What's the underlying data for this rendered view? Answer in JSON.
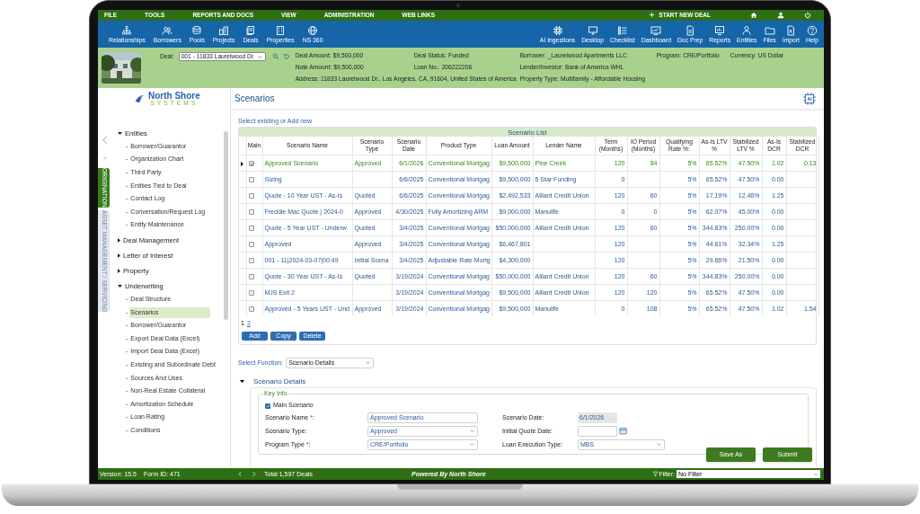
{
  "menu": {
    "items": [
      "FILE",
      "TOOLS",
      "REPORTS AND DOCS",
      "VIEW",
      "ADMINISTRATION",
      "WEB LINKS"
    ],
    "start_new_deal": "START NEW DEAL"
  },
  "toolbar": {
    "left": [
      "Relationships",
      "Borrowers",
      "Pools",
      "Projects",
      "Deals",
      "Properties",
      "NS 360"
    ],
    "right": [
      "AI Ingestions",
      "Desktop",
      "Checklist",
      "Dashboard",
      "Doc Prep",
      "Reports",
      "Entities",
      "Files",
      "Import",
      "Help"
    ]
  },
  "deal_header": {
    "deal_label": "Deal:",
    "deal_value": "001 - 11833 Laurelwood Dr.",
    "columns": [
      [
        {
          "label": "Deal Amount:",
          "value": "$9,500,000"
        },
        {
          "label": "Note Amount:",
          "value": "$9,500,000"
        },
        {
          "label": "Address:",
          "value": "11833 Laurelwood Dr., Los Angeles, CA, 91604, United States of America"
        }
      ],
      [
        {
          "label": "Deal Status:",
          "value": "Funded"
        },
        {
          "label": "Loan No.:",
          "value": "206222206"
        }
      ],
      [
        {
          "label": "Borrower:",
          "value": "_Laurelwood Apartments LLC"
        },
        {
          "label": "Lender/Investor:",
          "value": "Bank of America WHL"
        },
        {
          "label": "Property Type:",
          "value": "Multifamily - Affordable Housing"
        }
      ],
      [
        {
          "label": "Program:",
          "value": "CRE/Portfolio"
        }
      ],
      [
        {
          "label": "Currency:",
          "value": "US Dollar"
        }
      ]
    ]
  },
  "sidebar": {
    "logo": {
      "name": "North Shore",
      "tagline": "SYSTEMS"
    },
    "tabs": [
      {
        "label": "ORIGINATION",
        "selected": true
      },
      {
        "label": "ASSET MANAGEMENT / SERVICING",
        "selected": false
      }
    ],
    "sections": [
      {
        "label": "Entities",
        "expanded": true,
        "children": [
          {
            "dash": "-",
            "label": "Borrower/Guarantor",
            "selected": false
          },
          {
            "dash": "-",
            "label": "Organization Chart",
            "selected": false
          },
          {
            "dash": "-",
            "label": "Third Party",
            "selected": false
          },
          {
            "dash": "-",
            "label": "Entities Tied to Deal",
            "selected": false
          },
          {
            "dash": "-",
            "label": "Contact Log",
            "selected": false
          },
          {
            "dash": "-",
            "label": "Conversation/Request Log",
            "selected": false
          },
          {
            "dash": "-",
            "label": "Entity Maintenance",
            "selected": false
          }
        ]
      },
      {
        "label": "Deal Management",
        "expanded": false
      },
      {
        "label": "Letter of Interest",
        "expanded": false
      },
      {
        "label": "Property",
        "expanded": false
      },
      {
        "label": "Underwriting",
        "expanded": true,
        "children": [
          {
            "dash": "-",
            "label": "Deal Structure",
            "selected": false
          },
          {
            "dash": "-",
            "label": "Scenarios",
            "selected": true
          },
          {
            "dash": "-",
            "label": "Borrower/Guarantor",
            "selected": false
          },
          {
            "dash": "-",
            "label": "Export Deal Data (Excel)",
            "selected": false
          },
          {
            "dash": "-",
            "label": "Import Deal Data (Excel)",
            "selected": false
          },
          {
            "dash": "-",
            "label": "Existing and Subordinate Debt",
            "selected": false
          },
          {
            "dash": "-",
            "label": "Sources And Uses",
            "selected": false
          },
          {
            "dash": "-",
            "label": "Non-Real Estate Collateral",
            "selected": false
          },
          {
            "dash": "-",
            "label": "Amortization Schedule",
            "selected": false
          },
          {
            "dash": "-",
            "label": "Loan Rating",
            "selected": false
          },
          {
            "dash": "-",
            "label": "Conditions",
            "selected": false
          }
        ]
      }
    ]
  },
  "page_title": "Scenarios",
  "select_link": "Select existing or Add new",
  "scenario_list": {
    "title": "Scenario List",
    "columns": [
      "Main",
      "Scenario Name",
      "Scenario Type",
      "Scenario Date",
      "Product Type",
      "Loan Amount",
      "Lender Name",
      "Term (Months)",
      "IO Period (Months)",
      "Qualifying Rate %:",
      "As-Is LTV %",
      "Stabilized LTV %",
      "As-Is DCR",
      "Stabilized DCR"
    ],
    "rows": [
      {
        "selected": true,
        "main": true,
        "name": "Approved Scenario",
        "type": "Approved",
        "date": "6/1/2026",
        "product": "Conventional Mortgag",
        "amount": "$9,500,000",
        "lender": "Pine Creek",
        "term": "120",
        "io": "84",
        "rate": "5%",
        "asis_ltv": "65.52%",
        "stab_ltv": "47.50%",
        "asis_dcr": "1.02",
        "stab_dcr": "0.13"
      },
      {
        "selected": false,
        "main": false,
        "name": "Sizing",
        "date": "6/6/2025",
        "product": "Conventional Mortgag",
        "amount": "$9,500,000",
        "lender": "5 Star Funding",
        "term": "0",
        "rate": "5%",
        "asis_ltv": "65.52%",
        "stab_ltv": "47.50%",
        "asis_dcr": "0.00"
      },
      {
        "selected": false,
        "main": false,
        "name": "Quote - 10 Year UST - As-Is",
        "type": "Quoted",
        "date": "6/6/2025",
        "product": "Conventional Mortgag",
        "amount": "$2,492,533",
        "lender": "Alliant Credit Union",
        "term": "120",
        "io": "60",
        "rate": "5%",
        "asis_ltv": "17.19%",
        "stab_ltv": "12.46%",
        "asis_dcr": "1.25"
      },
      {
        "selected": false,
        "main": false,
        "name": "Freddie Mac Quote | 2024-0",
        "type": "Approved",
        "date": "4/30/2025",
        "product": "Fully Amortizing ARM",
        "amount": "$9,000,000",
        "lender": "Manulife",
        "term": "0",
        "io": "0",
        "rate": "5%",
        "asis_ltv": "62.07%",
        "stab_ltv": "45.00%",
        "asis_dcr": "0.00"
      },
      {
        "selected": false,
        "main": false,
        "name": "Quote - 5 Year UST - Underw",
        "type": "Quoted",
        "date": "3/4/2025",
        "product": "Conventional Mortgag",
        "amount": "$50,000,000",
        "lender": "Alliant Credit Union",
        "term": "120",
        "io": "60",
        "rate": "5%",
        "asis_ltv": "344.83%",
        "stab_ltv": "250.00%",
        "asis_dcr": "0.00"
      },
      {
        "selected": false,
        "main": false,
        "name": "Approved",
        "type": "Approved",
        "date": "3/4/2025",
        "product": "Conventional Mortgag",
        "amount": "$6,467,801",
        "term": "120",
        "rate": "5%",
        "asis_ltv": "44.61%",
        "stab_ltv": "32.34%",
        "asis_dcr": "1.25"
      },
      {
        "selected": false,
        "main": false,
        "name": "001 - 11|2024-03-07|00:49",
        "type": "Initial Scena",
        "date": "3/4/2025",
        "product": "Adjustable Rate Mortg",
        "amount": "$4,300,000",
        "term": "120",
        "rate": "5%",
        "asis_ltv": "29.66%",
        "stab_ltv": "21.50%",
        "asis_dcr": "0.00"
      },
      {
        "selected": false,
        "main": false,
        "name": "Quote - 30 Year UST - As-Is",
        "type": "Quoted",
        "date": "3/19/2024",
        "product": "Conventional Mortgag",
        "amount": "$50,000,000",
        "lender": "Alliant Credit Union",
        "term": "120",
        "io": "60",
        "rate": "5%",
        "asis_ltv": "344.83%",
        "stab_ltv": "250.00%",
        "asis_dcr": "0.00"
      },
      {
        "selected": false,
        "main": false,
        "name": "MJS Exit 2",
        "date": "3/19/2024",
        "product": "Conventional Mortgag",
        "amount": "$9,500,000",
        "lender": "Alliant Credit Union",
        "term": "120",
        "io": "120",
        "rate": "5%",
        "asis_ltv": "65.52%",
        "stab_ltv": "47.50%",
        "asis_dcr": "0.00"
      },
      {
        "selected": false,
        "main": false,
        "name": "Approved - 5 Years UST - Und",
        "type": "Approved",
        "date": "3/19/2024",
        "product": "Conventional Mortgag",
        "amount": "$9,500,000",
        "lender": "Manulife",
        "term": "0",
        "io": "108",
        "rate": "5%",
        "asis_ltv": "65.52%",
        "stab_ltv": "47.50%",
        "asis_dcr": "1.02",
        "stab_dcr": "1.54"
      }
    ],
    "pages": [
      {
        "label": "1",
        "selected": true
      },
      {
        "label": "2",
        "selected": false
      }
    ],
    "buttons": [
      "Add",
      "Copy",
      "Delete"
    ]
  },
  "select_function": {
    "label": "Select Function:",
    "value": "Scenario Details"
  },
  "details": {
    "title": "Scenario Details",
    "expanded": true,
    "group": "Key Info",
    "main_scenario": {
      "label": "Main Scenario",
      "checked": true
    },
    "left_fields": [
      {
        "label": "Scenario Name ",
        "required_mark": "*",
        "label_end": ":",
        "kind": "text",
        "value": "Approved Scenario"
      },
      {
        "label": "Scenario Type:",
        "kind": "select",
        "value": "Approved"
      },
      {
        "label": "Program Type ",
        "required_mark": "*",
        "label_end": ":",
        "kind": "select",
        "value": "CRE/Portfolio"
      }
    ],
    "right_fields": [
      {
        "label": "Scenario Date:",
        "kind": "readonly",
        "value": "6/1/2026"
      },
      {
        "label": "Initial Quote Date:",
        "kind": "date"
      },
      {
        "label": "Loan Execution Type:",
        "kind": "select",
        "value": "MBS"
      }
    ]
  },
  "actions": [
    "Save As",
    "Submit"
  ],
  "footer": {
    "version": "Version: 15.5",
    "form_id": "Form ID: 471",
    "total": "Total 1,597 Deals",
    "powered": "Powered By North Shore",
    "filter_label": "Filter:",
    "filter_value": "No Filter"
  }
}
